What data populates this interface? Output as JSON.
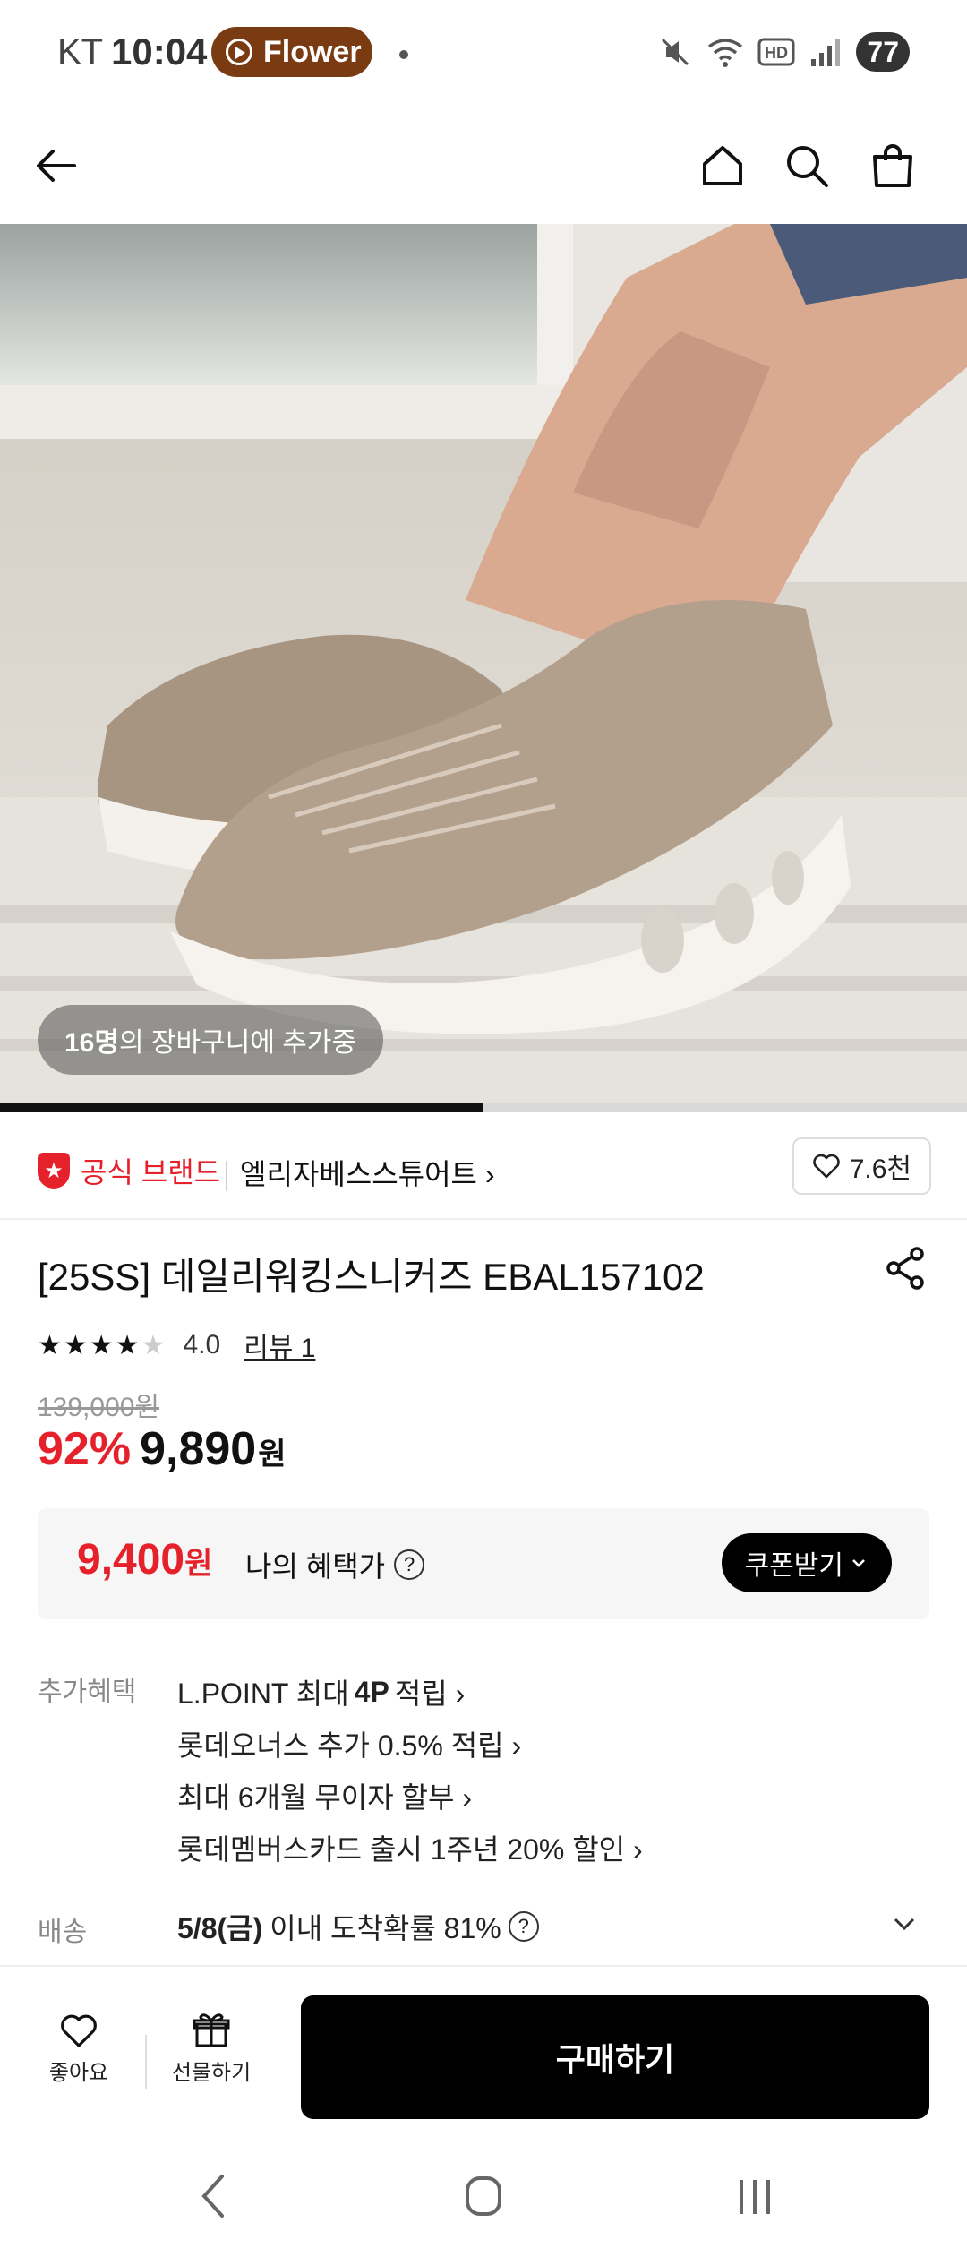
{
  "status_bar": {
    "carrier": "KT",
    "time": "10:04",
    "app_pill": "Flower",
    "battery": "77",
    "icons": [
      "mute-icon",
      "wifi-icon",
      "hd-icon",
      "signal-icon"
    ]
  },
  "nav": {
    "icons": [
      "back-arrow-icon",
      "home-icon",
      "search-icon",
      "shopping-bag-icon"
    ]
  },
  "hero": {
    "cart_count": "16명",
    "cart_text": "의 장바구니에 추가중",
    "slide_progress": 0.5
  },
  "brand": {
    "official_label": "공식 브랜드",
    "name": "엘리자베스스튜어트",
    "like_count": "7.6천"
  },
  "product": {
    "title": "[25SS] 데일리워킹스니커즈 EBAL157102",
    "rating": 4.0,
    "rating_text": "4.0",
    "review_link": "리뷰 1",
    "original_price": "139,000원",
    "discount": "92%",
    "price": "9,890",
    "currency": "원"
  },
  "benefit": {
    "price": "9,400",
    "currency": "원",
    "label": "나의 혜택가",
    "coupon_button": "쿠폰받기"
  },
  "extra": {
    "label": "추가혜택",
    "lines": [
      {
        "pre": "L.POINT 최대",
        "bold": "4P",
        "post": "적립 ›"
      },
      {
        "pre": "롯데오너스 추가 0.5% 적립 ›",
        "bold": "",
        "post": ""
      },
      {
        "pre": "최대 6개월 무이자 할부 ›",
        "bold": "",
        "post": ""
      },
      {
        "pre": "롯데멤버스카드 출시 1주년 20% 할인 ›",
        "bold": "",
        "post": ""
      }
    ]
  },
  "shipping": {
    "label": "배송",
    "date": "5/8(금)",
    "text": "이내 도착확률 81%"
  },
  "actions": {
    "like": "좋아요",
    "gift": "선물하기",
    "buy": "구매하기"
  },
  "colors": {
    "accent_red": "#e5222b",
    "black": "#000000",
    "pill_brown": "#7a3a12"
  }
}
